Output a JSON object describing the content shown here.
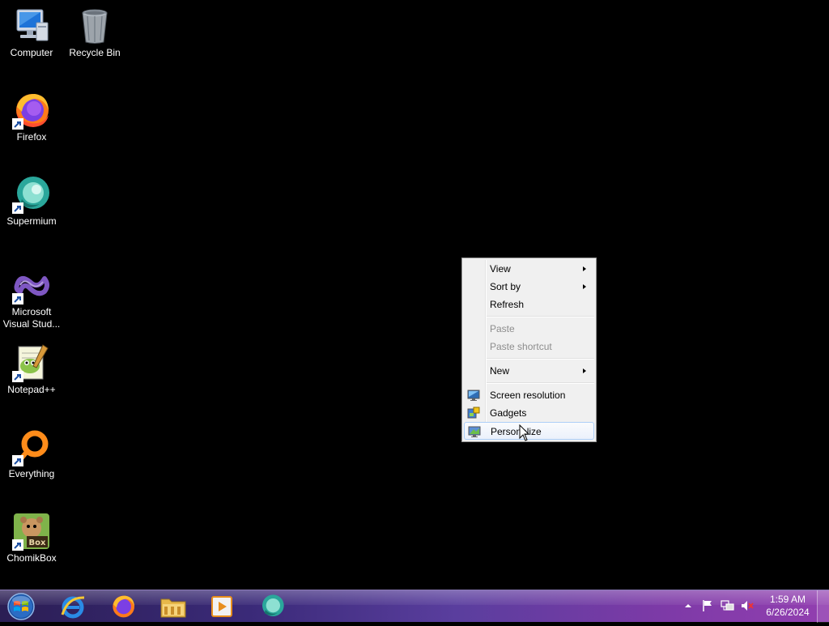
{
  "desktop": {
    "icons": [
      {
        "label": "Computer"
      },
      {
        "label": "Recycle Bin"
      },
      {
        "label": "Firefox"
      },
      {
        "label": "Supermium"
      },
      {
        "label": "Microsoft\nVisual Stud..."
      },
      {
        "label": "Notepad++"
      },
      {
        "label": "Everything"
      },
      {
        "label": "ChomikBox"
      }
    ]
  },
  "context_menu": {
    "items": [
      {
        "label": "View",
        "submenu": true
      },
      {
        "label": "Sort by",
        "submenu": true
      },
      {
        "label": "Refresh"
      },
      {
        "label": "Paste",
        "disabled": true
      },
      {
        "label": "Paste shortcut",
        "disabled": true
      },
      {
        "label": "New",
        "submenu": true
      },
      {
        "label": "Screen resolution",
        "icon": "display-icon"
      },
      {
        "label": "Gadgets",
        "icon": "gadgets-icon"
      },
      {
        "label": "Personalize",
        "icon": "personalize-icon",
        "highlighted": true
      }
    ]
  },
  "taskbar": {
    "pinned": [
      "start-orb",
      "internet-explorer-icon",
      "firefox-icon",
      "file-explorer-icon",
      "media-player-icon",
      "supermium-icon"
    ],
    "clock": {
      "time": "1:59 AM",
      "date": "6/26/2024"
    }
  }
}
